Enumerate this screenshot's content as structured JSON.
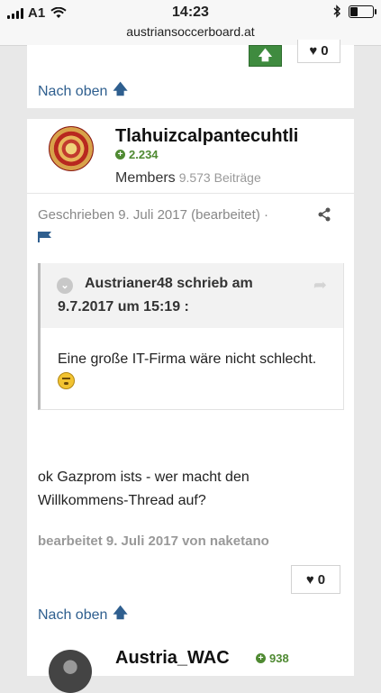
{
  "status_bar": {
    "carrier": "A1",
    "time": "14:23",
    "url": "austriansoccerboard.at",
    "battery_level": 0.3
  },
  "post_prev": {
    "reaction_count": "0",
    "back_to_top": "Nach oben"
  },
  "post": {
    "username": "Tlahuizcalpantecuhtli",
    "reputation": "2.234",
    "group": "Members",
    "post_count": "9.573 Beiträge",
    "posted": "Geschrieben 9. Juli 2017 (bearbeitet)",
    "posted_sep": "·",
    "quote": {
      "title_line1": "Austrianer48 schrieb am",
      "title_line2": "9.7.2017 um 15:19 :",
      "text": "Eine große IT-Firma wäre nicht schlecht."
    },
    "body": "ok Gazprom ists - wer macht den Willkommens-Thread auf?",
    "edited": "bearbeitet 9. Juli 2017 von naketano",
    "reaction_count": "0",
    "back_to_top": "Nach oben"
  },
  "post_next": {
    "username": "Austria_WAC",
    "reputation": "938"
  },
  "colors": {
    "link": "#2f5f8f",
    "reputation": "#4f8a32",
    "upvote": "#3f8b3f"
  }
}
